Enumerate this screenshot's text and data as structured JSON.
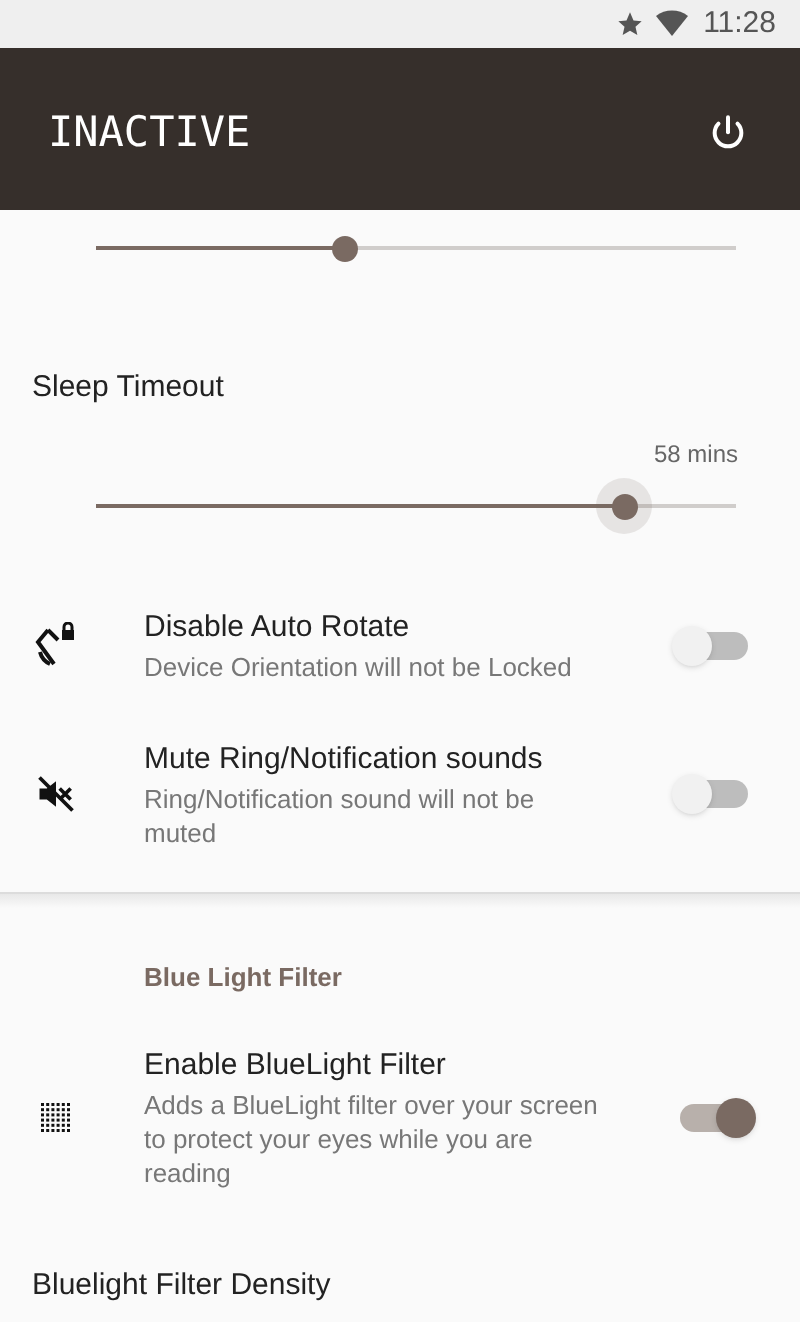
{
  "status_bar": {
    "time": "11:28"
  },
  "header": {
    "title": "INACTIVE"
  },
  "top_slider": {
    "level": 0.39
  },
  "sleep_timeout": {
    "title": "Sleep Timeout",
    "reading": "58 mins",
    "level": 0.825
  },
  "toggles": [
    {
      "kind": "rotate",
      "title": "Disable Auto Rotate",
      "summary": "Device Orientation will not be Locked",
      "on": false
    },
    {
      "kind": "mute",
      "title": "Mute Ring/Notification sounds",
      "summary": "Ring/Notification sound will not be muted",
      "on": false
    }
  ],
  "blue_light": {
    "category": "Blue Light Filter",
    "items": [
      {
        "kind": "filter",
        "title": "Enable BlueLight Filter",
        "summary": "Adds a BlueLight filter over your screen to protect your eyes while you are reading",
        "on": true
      }
    ],
    "density_title": "Bluelight Filter Density"
  }
}
